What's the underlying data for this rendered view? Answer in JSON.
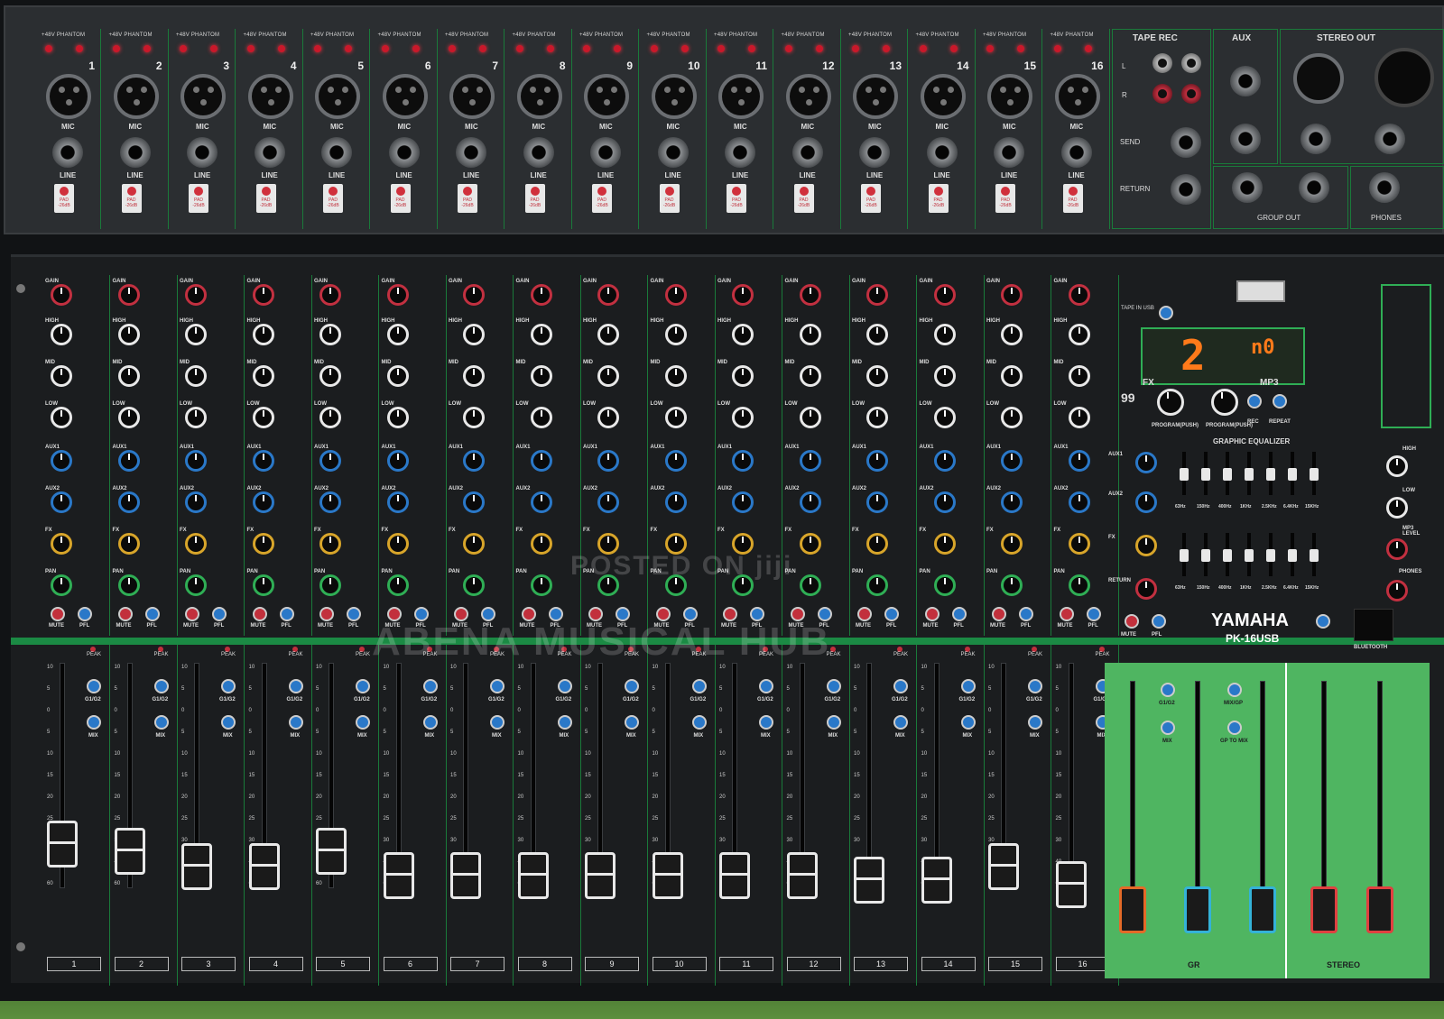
{
  "channels": [
    {
      "n": "1"
    },
    {
      "n": "2"
    },
    {
      "n": "3"
    },
    {
      "n": "4"
    },
    {
      "n": "5"
    },
    {
      "n": "6"
    },
    {
      "n": "7"
    },
    {
      "n": "8"
    },
    {
      "n": "9"
    },
    {
      "n": "10"
    },
    {
      "n": "11"
    },
    {
      "n": "12"
    },
    {
      "n": "13"
    },
    {
      "n": "14"
    },
    {
      "n": "15"
    },
    {
      "n": "16"
    }
  ],
  "jack_labels": {
    "phantom": "+48V  PHANTOM",
    "mic": "MIC",
    "line": "LINE",
    "pad": "PAD -26dB"
  },
  "io_section": {
    "tape_rec": "TAPE   REC",
    "aux": "AUX",
    "stereo_out": "STEREO OUT",
    "send": "SEND",
    "return": "RETURN",
    "group_out": "GROUP OUT",
    "phones": "PHONES",
    "left": "L",
    "right": "R"
  },
  "knob_labels": {
    "gain": "GAIN",
    "high": "HIGH",
    "mid": "MID",
    "low": "LOW",
    "aux1": "AUX1",
    "aux2": "AUX2",
    "fx": "FX",
    "pan": "PAN",
    "mute": "MUTE",
    "pfl": "PFL",
    "peak": "PEAK",
    "g1g2": "G1/G2",
    "mix": "MIX"
  },
  "strip_numbers": [
    "1",
    "2",
    "3",
    "4",
    "5",
    "6",
    "7",
    "8",
    "9",
    "10",
    "11",
    "12",
    "13",
    "14",
    "15",
    "16"
  ],
  "fader_scale": [
    "10",
    "5",
    "0",
    "5",
    "10",
    "15",
    "20",
    "25",
    "30",
    "40",
    "60"
  ],
  "master": {
    "display_fx": "2",
    "display_mp3": "n0",
    "fx_count": "99",
    "fx_label": "FX",
    "mp3_label": "MP3",
    "program_push_1": "PROGRAM(PUSH)",
    "program_push_2": "PROGRAM(PUSH)",
    "rec": "REC",
    "repeat": "REPEAT",
    "tape_usb": "TAPE IN USB",
    "graphic_eq": "GRAPHIC EQUALIZER",
    "eq_bands": [
      "63Hz",
      "150Hz",
      "400Hz",
      "1KHz",
      "2.5KHz",
      "6.4KHz",
      "15KHz"
    ],
    "high": "HIGH",
    "low": "LOW",
    "mp3_level": "MP3 LEVEL",
    "phones": "PHONES",
    "aux1": "AUX1",
    "aux2": "AUX2",
    "fx": "FX",
    "return": "RETURN",
    "mute": "MUTE",
    "pfl": "PFL",
    "brand": "YAMAHA",
    "model": "PK-16USB",
    "bluetooth": "BLUETOOTH",
    "g1g2": "G1/G2",
    "mix": "MIX",
    "mix_gp": "MIX/GP",
    "gp_to_mix": "GP TO MIX",
    "group": "GR",
    "stereo": "STEREO"
  },
  "watermark_1": "POSTED ON jiji",
  "watermark_2": "ABENA MUSICAL HUB",
  "colors": {
    "panel": "#2b2e31",
    "surface": "#1b1d1f",
    "accent_green": "#2fae55",
    "knob_red": "#c23040",
    "knob_blue": "#2a78c8",
    "knob_yellow": "#d8a52a",
    "display_orange": "#ff7a1a"
  },
  "fader_levels": [
    0.18,
    0.15,
    0.08,
    0.08,
    0.15,
    0.04,
    0.04,
    0.04,
    0.04,
    0.04,
    0.04,
    0.04,
    0.02,
    0.02,
    0.08,
    0.0
  ]
}
